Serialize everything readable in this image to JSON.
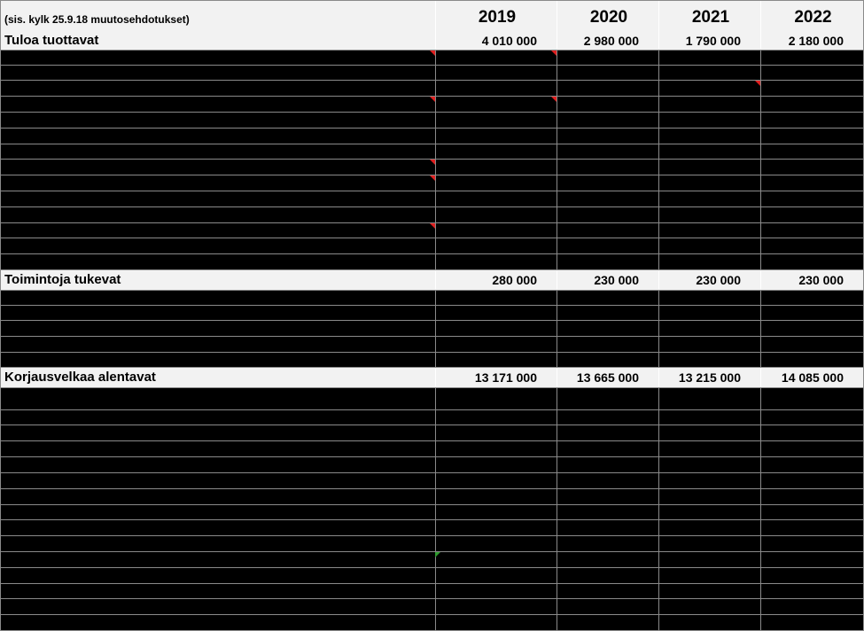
{
  "sheet": {
    "note": "(sis. kylk 25.9.18 muutosehdotukset)",
    "years": [
      "2019",
      "2020",
      "2021",
      "2022"
    ],
    "sections": [
      {
        "label": "Tuloa tuottavat",
        "values": [
          "4 010 000",
          "2 980 000",
          "1 790 000",
          "2 180 000"
        ]
      },
      {
        "label": "Toimintoja tukevat",
        "values": [
          "280 000",
          "230 000",
          "230 000",
          "230 000"
        ]
      },
      {
        "label": "Korjausvelkaa alentavat",
        "values": [
          "13 171 000",
          "13 665 000",
          "13 215 000",
          "14 085 000"
        ]
      }
    ]
  },
  "colors": {
    "background": "#000000",
    "band": "#f2f2f2",
    "gridline": "#8a8a8a",
    "comment_marker": "#e02020",
    "green_marker": "#2e9a2e"
  }
}
